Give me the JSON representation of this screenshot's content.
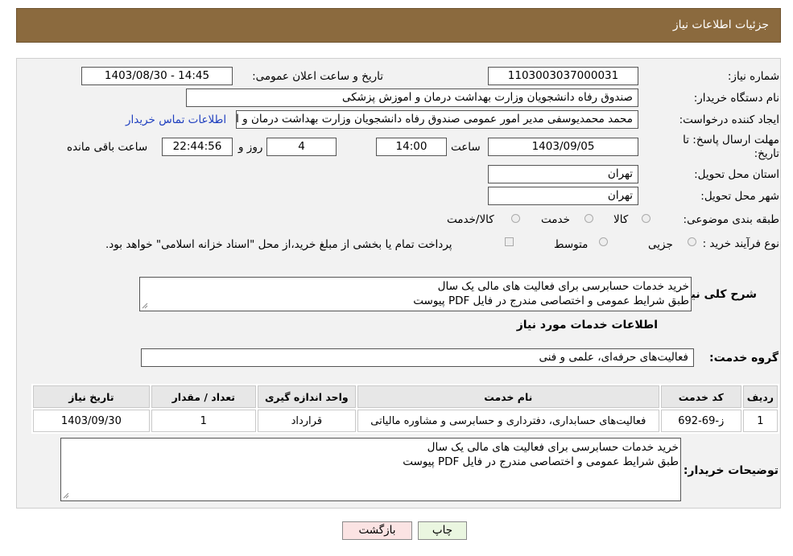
{
  "header": {
    "title": "جزئیات اطلاعات نیاز"
  },
  "form": {
    "need_number_label": "شماره نیاز:",
    "need_number": "1103003037000031",
    "announce_label": "تاریخ و ساعت اعلان عمومی:",
    "announce_value": "1403/08/30 - 14:45",
    "buyer_org_label": "نام دستگاه خریدار:",
    "buyer_org": "صندوق رفاه دانشجویان وزارت بهداشت  درمان و اموزش پزشکی",
    "creator_label": "ایجاد کننده درخواست:",
    "creator": "محمد محمدیوسفی مدیر امور عمومی صندوق رفاه دانشجویان وزارت بهداشت  درمان و اموزش پزشکی",
    "contact_link": "اطلاعات تماس خریدار",
    "deadline_label_1": "مهلت ارسال پاسخ: تا",
    "deadline_label_2": "تاریخ:",
    "deadline_date": "1403/09/05",
    "time_label": "ساعت",
    "deadline_time": "14:00",
    "days_value": "4",
    "days_label": "روز و",
    "remaining_value": "22:44:56",
    "remaining_label": "ساعت باقی مانده",
    "province_label": "استان محل تحویل:",
    "province": "تهران",
    "city_label": "شهر محل تحویل:",
    "city": "تهران",
    "category_label": "طبقه بندی موضوعی:",
    "category_options": [
      "کالا",
      "خدمت",
      "کالا/خدمت"
    ],
    "purchase_type_label": "نوع فرآیند خرید :",
    "purchase_options": [
      "جزیی",
      "متوسط"
    ],
    "payment_note": "پرداخت تمام یا بخشی از مبلغ خرید،از محل \"اسناد خزانه اسلامی\" خواهد بود."
  },
  "summary": {
    "label": "شرح کلی نیاز:",
    "line1": "خرید خدمات حسابرسی برای فعالیت های مالی یک سال",
    "line2": "طبق شرایط عمومی و اختصاصی مندرج در فایل PDF پیوست"
  },
  "services": {
    "section_title": "اطلاعات خدمات مورد نیاز",
    "group_label": "گروه خدمت:",
    "group_value": "فعالیت‌های حرفه‌ای، علمی و فنی",
    "columns": [
      "ردیف",
      "کد خدمت",
      "نام خدمت",
      "واحد اندازه گیری",
      "تعداد / مقدار",
      "تاریخ نیاز"
    ],
    "rows": [
      [
        "1",
        "ز-69-692",
        "فعالیت‌های حسابداری، دفترداری و حسابرسی و مشاوره مالیاتی",
        "قرارداد",
        "1",
        "1403/09/30"
      ]
    ]
  },
  "buyer_notes": {
    "label": "توضیحات خریدار:",
    "line1": "خرید خدمات حسابرسی برای فعالیت های مالی یک سال",
    "line2": "طبق شرایط عمومی و اختصاصی مندرج در فایل PDF پیوست"
  },
  "buttons": {
    "print": "چاپ",
    "back": "بازگشت"
  },
  "colors": {
    "header_bg": "#8b6a3e",
    "link": "#1f3fbf",
    "print_bg": "#eaf6e0",
    "back_bg": "#fbe3e3"
  }
}
